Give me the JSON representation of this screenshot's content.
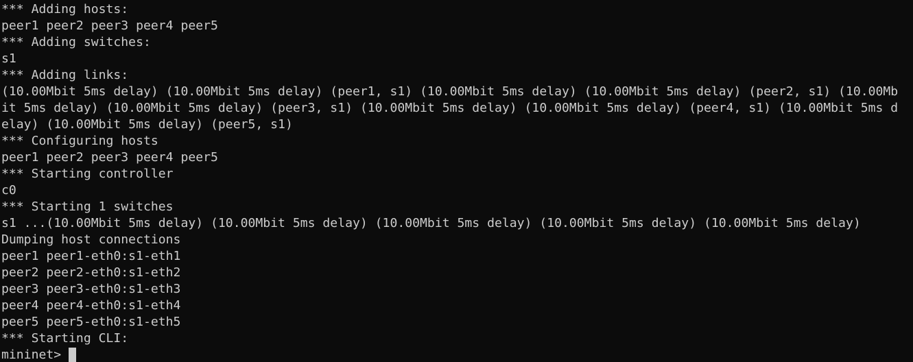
{
  "terminal": {
    "lines": [
      "*** Adding hosts:",
      "peer1 peer2 peer3 peer4 peer5",
      "*** Adding switches:",
      "s1",
      "*** Adding links:",
      "(10.00Mbit 5ms delay) (10.00Mbit 5ms delay) (peer1, s1) (10.00Mbit 5ms delay) (10.00Mbit 5ms delay) (peer2, s1) (10.00Mb",
      "it 5ms delay) (10.00Mbit 5ms delay) (peer3, s1) (10.00Mbit 5ms delay) (10.00Mbit 5ms delay) (peer4, s1) (10.00Mbit 5ms d",
      "elay) (10.00Mbit 5ms delay) (peer5, s1)",
      "*** Configuring hosts",
      "peer1 peer2 peer3 peer4 peer5",
      "*** Starting controller",
      "c0",
      "*** Starting 1 switches",
      "s1 ...(10.00Mbit 5ms delay) (10.00Mbit 5ms delay) (10.00Mbit 5ms delay) (10.00Mbit 5ms delay) (10.00Mbit 5ms delay)",
      "Dumping host connections",
      "peer1 peer1-eth0:s1-eth1",
      "peer2 peer2-eth0:s1-eth2",
      "peer3 peer3-eth0:s1-eth3",
      "peer4 peer4-eth0:s1-eth4",
      "peer5 peer5-eth0:s1-eth5",
      "*** Starting CLI:"
    ],
    "prompt": "mininet> ",
    "colors": {
      "background": "#0c0c0c",
      "foreground": "#cccccc",
      "cursor": "#cccccc"
    }
  }
}
